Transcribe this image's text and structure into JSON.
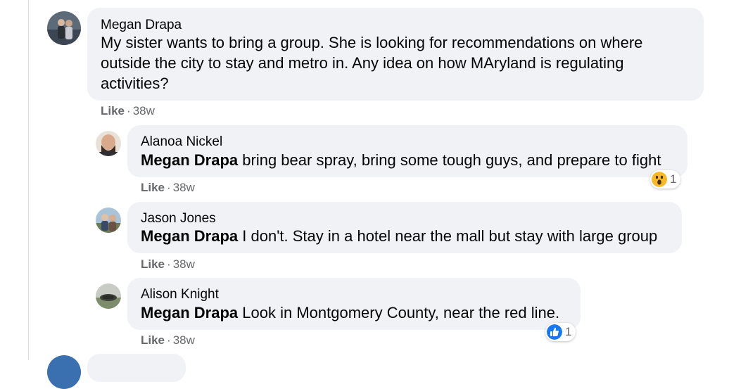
{
  "comments": [
    {
      "author": "Megan Drapa",
      "text": "My sister wants to bring a group. She is looking for recommendations on where outside the city to stay and metro in. Any idea on how MAryland is regulating activities?",
      "like_label": "Like",
      "sep": "·",
      "time": "38w"
    }
  ],
  "replies": [
    {
      "author": "Alanoa Nickel",
      "mention": "Megan Drapa",
      "text": " bring bear spray, bring some tough guys, and prepare to fight",
      "like_label": "Like",
      "sep": "·",
      "time": "38w",
      "reaction": {
        "icon": "wow-icon",
        "count": "1"
      }
    },
    {
      "author": "Jason Jones",
      "mention": "Megan Drapa",
      "text": " I don't. Stay in a hotel near the mall but stay with large group",
      "like_label": "Like",
      "sep": "·",
      "time": "38w"
    },
    {
      "author": "Alison Knight",
      "mention": "Megan Drapa",
      "text": " Look in Montgomery County, near the red line.",
      "like_label": "Like",
      "sep": "·",
      "time": "38w",
      "reaction": {
        "icon": "like-icon",
        "count": "1"
      }
    }
  ],
  "colors": {
    "bubble": "#f0f2f5",
    "meta": "#65676b",
    "like_blue": "#1877f2",
    "wow_yellow": "#f7b928"
  }
}
